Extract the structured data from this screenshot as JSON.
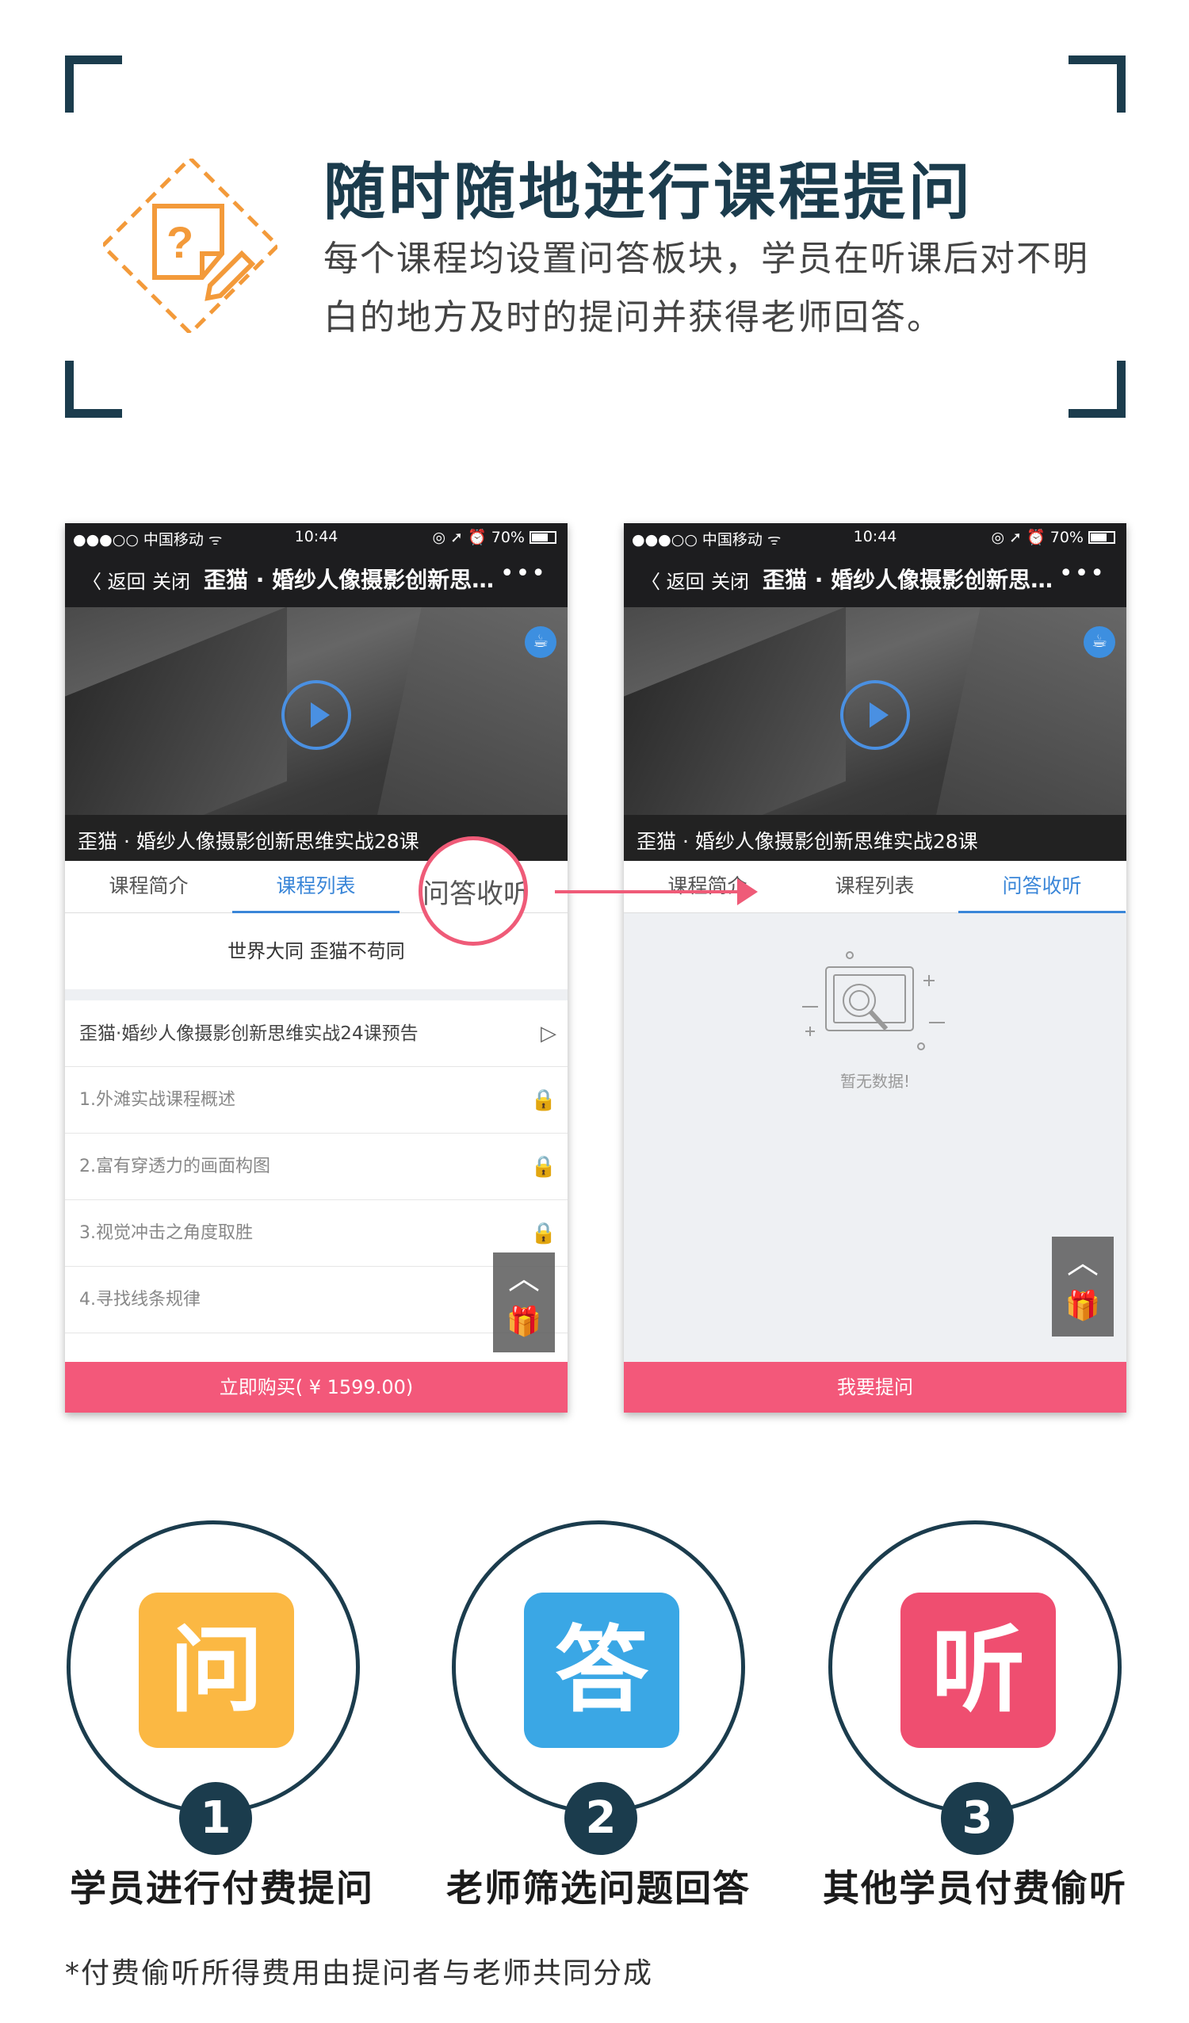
{
  "header": {
    "title": "随时随地进行课程提问",
    "subtitle": "每个课程均设置问答板块，学员在听课后对不明白的地方及时的提问并获得老师回答。"
  },
  "status_bar": {
    "carrier": "●●●○○ 中国移动 ᯤ",
    "time": "10:44",
    "right": "◎ ➚ ⏰ 70%"
  },
  "nav": {
    "back_label": "〈 返回",
    "close_label": "关闭",
    "title": "歪猫 · 婚纱人像摄影创新思维实战28课",
    "more_label": "•••"
  },
  "video": {
    "caption": "歪猫 · 婚纱人像摄影创新思维实战28课",
    "cup_icon": "☕"
  },
  "tabs": [
    "课程简介",
    "课程列表",
    "问答收听"
  ],
  "magnifier_label": "问答收听",
  "left_phone": {
    "motto": "世界大同 歪猫不苟同",
    "items": [
      {
        "label": "歪猫·婚纱人像摄影创新思维实战24课预告",
        "icon": "▷"
      },
      {
        "label": "1.外滩实战课程概述",
        "icon": "🔒"
      },
      {
        "label": "2.富有穿透力的画面构图",
        "icon": "🔒"
      },
      {
        "label": "3.视觉冲击之角度取胜",
        "icon": "🔒"
      },
      {
        "label": "4.寻找线条规律",
        "icon": ""
      }
    ],
    "buy_label": "立即购买( ¥ 1599.00)"
  },
  "right_phone": {
    "empty_text": "暂无数据!",
    "ask_label": "我要提问"
  },
  "float_buttons": {
    "up": "︿",
    "gift": "🎁"
  },
  "steps": [
    {
      "char": "问",
      "num": "1",
      "label": "学员进行付费提问",
      "color": "#fbb843"
    },
    {
      "char": "答",
      "num": "2",
      "label": "老师筛选问题回答",
      "color": "#3aa7e5"
    },
    {
      "char": "听",
      "num": "3",
      "label": "其他学员付费偷听",
      "color": "#ef4e70"
    }
  ],
  "footnote": "*付费偷听所得费用由提问者与老师共同分成",
  "colors": {
    "navy": "#1b3c4d",
    "orange": "#f39a3a",
    "pink": "#f3587a",
    "blue": "#3a86d8"
  }
}
